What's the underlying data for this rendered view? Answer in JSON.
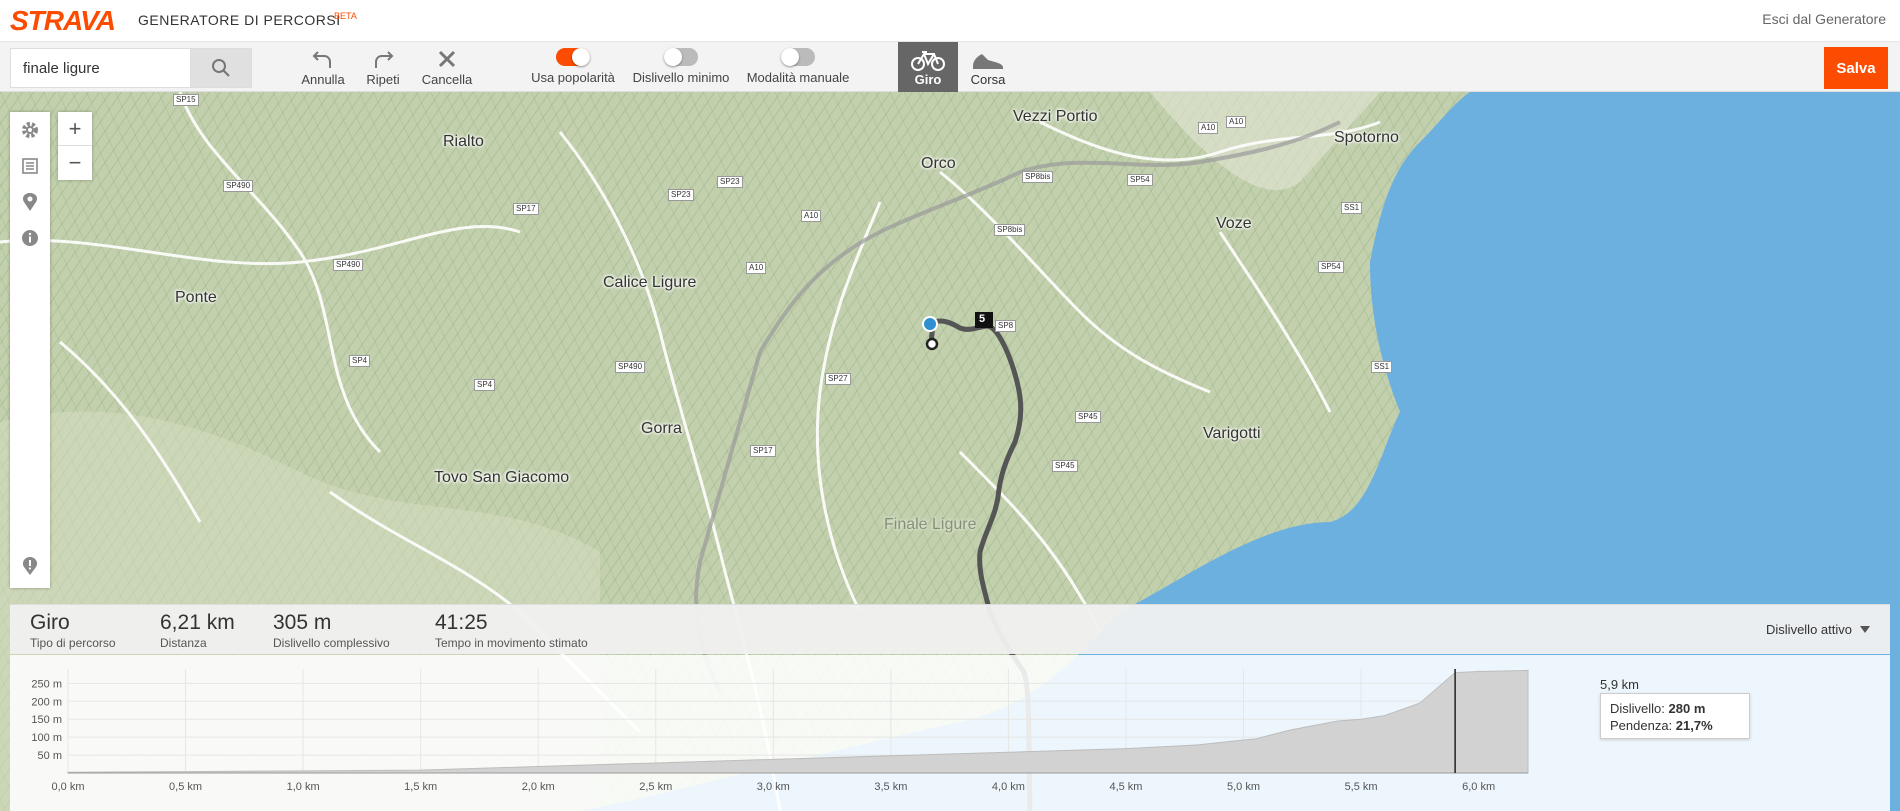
{
  "header": {
    "logo": "STRAVA",
    "title": "GENERATORE DI PERCORSI",
    "beta": "BETA",
    "exit_label": "Esci dal Generatore"
  },
  "toolbar": {
    "search_value": "finale ligure",
    "undo_label": "Annulla",
    "redo_label": "Ripeti",
    "clear_label": "Cancella",
    "popularity_label": "Usa popolarità",
    "popularity_on": true,
    "min_elevation_label": "Dislivello minimo",
    "min_elevation_on": false,
    "manual_mode_label": "Modalità manuale",
    "manual_mode_on": false,
    "ride_label": "Giro",
    "run_label": "Corsa",
    "active_sport": "ride",
    "save_label": "Salva",
    "accent_color": "#fc4c02"
  },
  "map": {
    "places": [
      "Vezzi Portio",
      "Spotorno",
      "Rialto",
      "Orco",
      "Voze",
      "Calice Ligure",
      "Ponte",
      "Gorra",
      "Varigotti",
      "Tovo San Giacomo",
      "Finale Ligure"
    ],
    "road_tags": [
      "SP15",
      "SP490",
      "SP17",
      "SP23",
      "SP23",
      "A10",
      "A10",
      "SP8bis",
      "SP8bis",
      "SP54",
      "SS1",
      "A10",
      "A10",
      "SP490",
      "SP54",
      "SP8",
      "SP4",
      "SP4",
      "SP490",
      "SP27",
      "SS1",
      "SP45",
      "SP17",
      "SP45"
    ],
    "route_marker": "5",
    "sea_color": "#6cb0e0",
    "route_color": "#555555"
  },
  "stats": {
    "type_value": "Giro",
    "type_label": "Tipo di percorso",
    "distance_value": "6,21 km",
    "distance_label": "Distanza",
    "elevation_value": "305 m",
    "elevation_label": "Dislivello complessivo",
    "time_value": "41:25",
    "time_label": "Tempo in movimento stimato",
    "elevation_mode": "Dislivello attivo"
  },
  "tooltip": {
    "km": "5,9 km",
    "elev_label": "Dislivello:",
    "elev_value": "280 m",
    "grade_label": "Pendenza:",
    "grade_value": "21,7%"
  },
  "chart_data": {
    "type": "area",
    "x": [
      0,
      0.5,
      1.0,
      1.5,
      2.0,
      2.5,
      3.0,
      3.5,
      4.0,
      4.5,
      4.8,
      5.0,
      5.05,
      5.2,
      5.4,
      5.5,
      5.6,
      5.75,
      5.9,
      6.0,
      6.21
    ],
    "values": [
      2,
      4,
      6,
      8,
      18,
      28,
      38,
      48,
      58,
      68,
      78,
      92,
      95,
      120,
      145,
      150,
      160,
      195,
      280,
      283,
      286
    ],
    "xticks": [
      "0,0 km",
      "0,5 km",
      "1,0 km",
      "1,5 km",
      "2,0 km",
      "2,5 km",
      "3,0 km",
      "3,5 km",
      "4,0 km",
      "4,5 km",
      "5,0 km",
      "5,5 km",
      "6,0 km"
    ],
    "yticks": [
      "250 m",
      "200 m",
      "150 m",
      "100 m",
      "50 m"
    ],
    "xlim": [
      0,
      6.21
    ],
    "ylim": [
      0,
      290
    ],
    "cursor_x": 5.9,
    "grid": true
  }
}
